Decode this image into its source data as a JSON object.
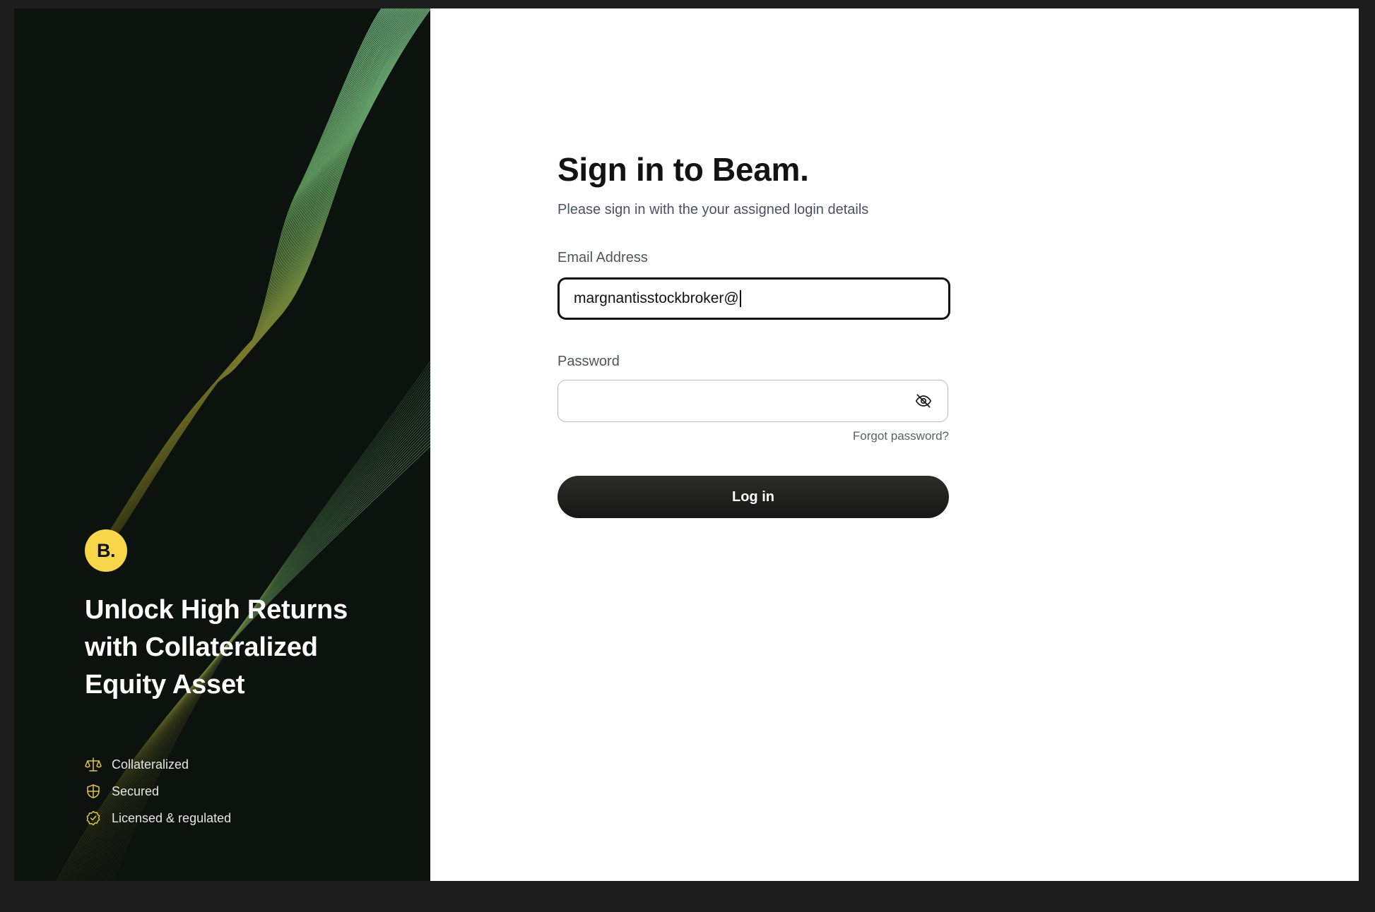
{
  "left_panel": {
    "logo_text": "B.",
    "hero_title": "Unlock High Returns with Collateralized Equity Asset",
    "features": [
      {
        "label": "Collateralized",
        "icon": "scale-icon"
      },
      {
        "label": "Secured",
        "icon": "shield-icon"
      },
      {
        "label": "Licensed & regulated",
        "icon": "badge-check-icon"
      }
    ]
  },
  "form": {
    "title": "Sign in to Beam.",
    "subtitle": "Please sign in with the your assigned login details",
    "email_label": "Email Address",
    "email_value": "margnantisstockbroker@",
    "password_label": "Password",
    "password_value": "",
    "forgot_password": "Forgot password?",
    "login_label": "Log in"
  },
  "colors": {
    "left_background": "#0c120e",
    "brand_yellow": "#f7d64a",
    "button_dark": "#1c1c1b",
    "wave_green": "#7fcf8a",
    "wave_olive": "#8a8a2a"
  }
}
